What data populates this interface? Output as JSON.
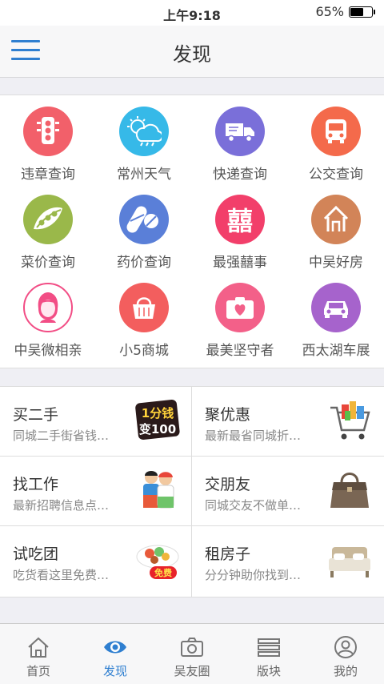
{
  "status_bar": {
    "time": "上午9:18",
    "battery": "65%",
    "battery_level": 0.65
  },
  "header": {
    "title": "发现",
    "menu_icon": "hamburger-menu-icon"
  },
  "grid": [
    {
      "label": "违章查询",
      "icon": "traffic-light-icon",
      "color": "#f2606a"
    },
    {
      "label": "常州天气",
      "icon": "weather-icon",
      "color": "#36b9e8"
    },
    {
      "label": "快递查询",
      "icon": "truck-icon",
      "color": "#7a6fd9"
    },
    {
      "label": "公交查询",
      "icon": "bus-icon",
      "color": "#f46a4b"
    },
    {
      "label": "菜价查询",
      "icon": "pea-icon",
      "color": "#9ab84a"
    },
    {
      "label": "药价查询",
      "icon": "pill-icon",
      "color": "#5a7fd8"
    },
    {
      "label": "最强囍事",
      "icon": "double-happiness-icon",
      "color": "#f23f6a"
    },
    {
      "label": "中吴好房",
      "icon": "house-icon",
      "color": "#d28458"
    },
    {
      "label": "中吴微相亲",
      "icon": "girl-avatar-icon",
      "color": "#f24d85"
    },
    {
      "label": "小5商城",
      "icon": "shopping-bag-icon",
      "color": "#f35e5e"
    },
    {
      "label": "最美坚守者",
      "icon": "camera-heart-icon",
      "color": "#f36089"
    },
    {
      "label": "西太湖车展",
      "icon": "car-icon",
      "color": "#a663cc"
    }
  ],
  "cards": [
    {
      "title": "买二手",
      "sub": "同城二手街省钱…",
      "thumb": "one-cent-sticker",
      "thumb_text": "1分钱 变100"
    },
    {
      "title": "聚优惠",
      "sub": "最新最省同城折…",
      "thumb": "shopping-cart"
    },
    {
      "title": "找工作",
      "sub": "最新招聘信息点…",
      "thumb": "workers-photo"
    },
    {
      "title": "交朋友",
      "sub": "同城交友不做单…",
      "thumb": "handbag-photo"
    },
    {
      "title": "试吃团",
      "sub": "吃货看这里免费…",
      "thumb": "free-food-plate",
      "thumb_text": "免费"
    },
    {
      "title": "租房子",
      "sub": "分分钟助你找到…",
      "thumb": "bed-photo"
    }
  ],
  "tabs": [
    {
      "label": "首页",
      "icon": "home-icon",
      "active": false
    },
    {
      "label": "发现",
      "icon": "eye-icon",
      "active": true
    },
    {
      "label": "吴友圈",
      "icon": "camera-icon",
      "active": false
    },
    {
      "label": "版块",
      "icon": "list-icon",
      "active": false
    },
    {
      "label": "我的",
      "icon": "user-icon",
      "active": false
    }
  ]
}
